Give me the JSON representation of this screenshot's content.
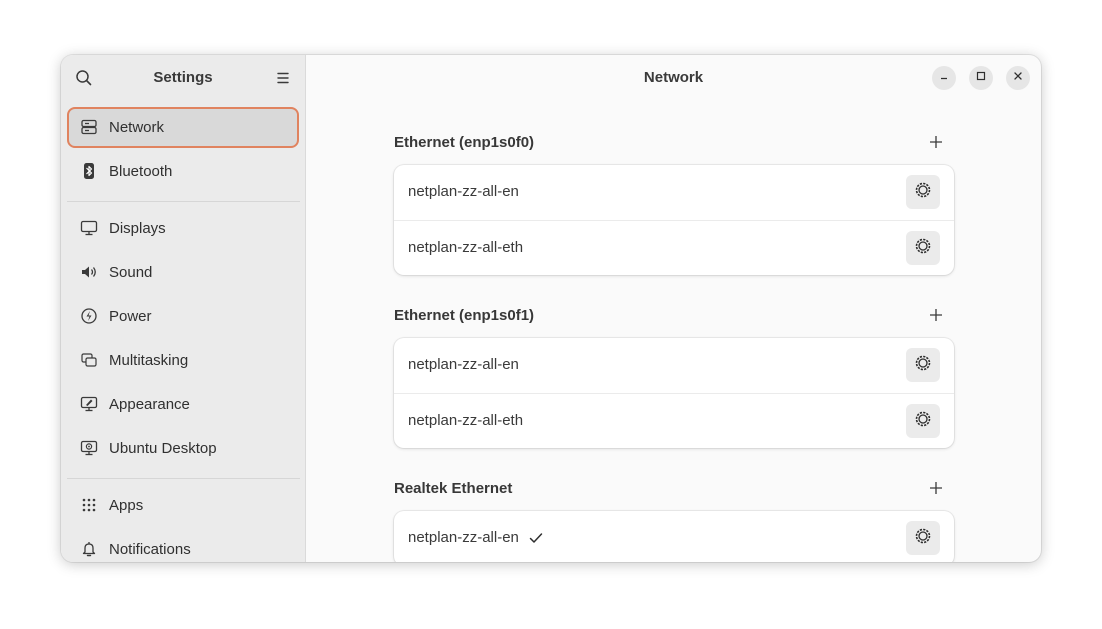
{
  "sidebar": {
    "title": "Settings",
    "items": [
      {
        "label": "Network",
        "icon": "network-icon",
        "active": true
      },
      {
        "label": "Bluetooth",
        "icon": "bluetooth-icon"
      },
      {
        "label": "Displays",
        "icon": "display-icon"
      },
      {
        "label": "Sound",
        "icon": "speaker-icon"
      },
      {
        "label": "Power",
        "icon": "power-icon"
      },
      {
        "label": "Multitasking",
        "icon": "multitasking-icon"
      },
      {
        "label": "Appearance",
        "icon": "appearance-icon"
      },
      {
        "label": "Ubuntu Desktop",
        "icon": "ubuntu-desktop-icon"
      },
      {
        "label": "Apps",
        "icon": "apps-grid-icon"
      },
      {
        "label": "Notifications",
        "icon": "bell-icon"
      }
    ]
  },
  "main": {
    "title": "Network",
    "sections": [
      {
        "title": "Ethernet (enp1s0f0)",
        "connections": [
          {
            "name": "netplan-zz-all-en"
          },
          {
            "name": "netplan-zz-all-eth"
          }
        ]
      },
      {
        "title": "Ethernet (enp1s0f1)",
        "connections": [
          {
            "name": "netplan-zz-all-en"
          },
          {
            "name": "netplan-zz-all-eth"
          }
        ]
      },
      {
        "title": "Realtek Ethernet",
        "connections": [
          {
            "name": "netplan-zz-all-en",
            "active": true
          }
        ]
      }
    ]
  },
  "colors": {
    "accent": "#e0835f",
    "sidebar_bg": "#ebebeb",
    "content_bg": "#fafafa"
  }
}
